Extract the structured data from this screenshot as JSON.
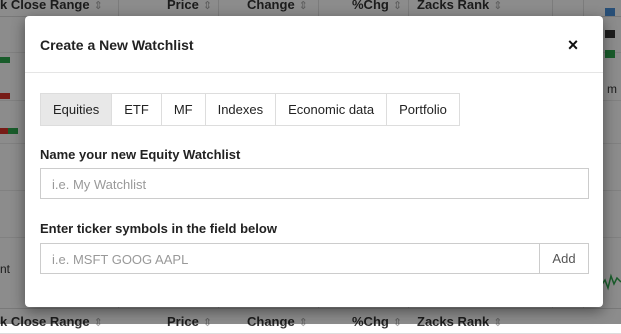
{
  "background_table": {
    "columns": [
      {
        "label": "k Close Range",
        "sort": "⇕"
      },
      {
        "label": "Price",
        "sort": "⇕"
      },
      {
        "label": "Change",
        "sort": "⇕"
      },
      {
        "label": "%Chg",
        "sort": "⇕"
      },
      {
        "label": "Zacks Rank",
        "sort": "⇕"
      }
    ],
    "side_text_right": "m",
    "side_text_left": "nt",
    "colors": {
      "red": "#d9342b",
      "green": "#2fa84f",
      "accent_blue": "#4a90d9"
    }
  },
  "modal": {
    "title": "Create a New Watchlist",
    "close_icon": "×",
    "tabs": [
      {
        "label": "Equities",
        "active": true
      },
      {
        "label": "ETF",
        "active": false
      },
      {
        "label": "MF",
        "active": false
      },
      {
        "label": "Indexes",
        "active": false
      },
      {
        "label": "Economic data",
        "active": false
      },
      {
        "label": "Portfolio",
        "active": false
      }
    ],
    "name_label": "Name your new Equity Watchlist",
    "name_placeholder": "i.e. My Watchlist",
    "ticker_label": "Enter ticker symbols in the field below",
    "ticker_placeholder": "i.e. MSFT GOOG AAPL",
    "add_label": "Add"
  }
}
